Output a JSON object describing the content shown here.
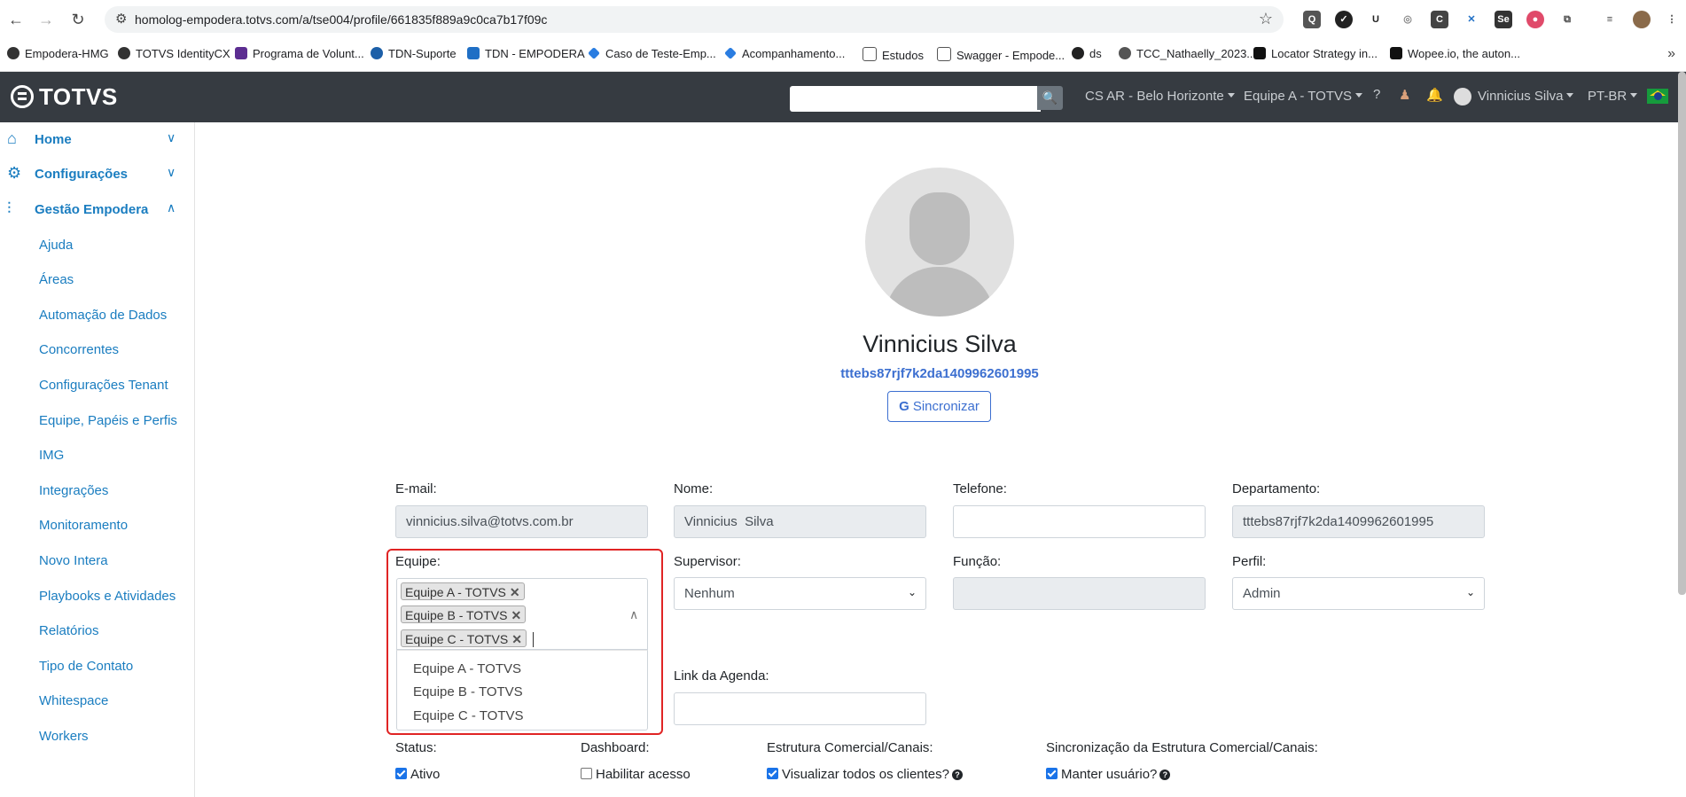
{
  "browser": {
    "url": "homolog-empodera.totvs.com/a/tse004/profile/661835f889a9c0ca7b17f09c",
    "bookmarks": [
      "Empodera-HMG",
      "TOTVS IdentityCX",
      "Programa de Volunt...",
      "TDN-Suporte",
      "TDN - EMPODERA",
      "Caso de Teste-Emp...",
      "Acompanhamento...",
      "Estudos",
      "Swagger - Empode...",
      "ds",
      "TCC_Nathaelly_2023...",
      "Locator Strategy in...",
      "Wopee.io, the auton..."
    ]
  },
  "header": {
    "logo_text": "TOTVS",
    "search_placeholder": "",
    "location": "CS AR - Belo Horizonte",
    "team": "Equipe A - TOTVS",
    "user": "Vinnicius Silva",
    "language": "PT-BR"
  },
  "sidebar": {
    "main_items": [
      {
        "label": "Home",
        "icon": "home-icon"
      },
      {
        "label": "Configurações",
        "icon": "gear-icon"
      },
      {
        "label": "Gestão Empodera",
        "icon": "sliders-icon"
      }
    ],
    "sub_items": [
      "Ajuda",
      "Áreas",
      "Automação de Dados",
      "Concorrentes",
      "Configurações Tenant",
      "Equipe, Papéis e Perfis",
      "IMG",
      "Integrações",
      "Monitoramento",
      "Novo Intera",
      "Playbooks e Atividades",
      "Relatórios",
      "Tipo de Contato",
      "Whitespace",
      "Workers"
    ]
  },
  "profile": {
    "name": "Vinnicius Silva",
    "id": "tttebs87rjf7k2da1409962601995",
    "sync_label": "Sincronizar"
  },
  "form": {
    "email_label": "E-mail:",
    "email_value": "vinnicius.silva@totvs.com.br",
    "nome_label": "Nome:",
    "nome_value": "Vinnicius  Silva",
    "telefone_label": "Telefone:",
    "telefone_value": "",
    "departamento_label": "Departamento:",
    "departamento_value": "tttebs87rjf7k2da1409962601995",
    "equipe_label": "Equipe:",
    "equipe_selected": [
      "Equipe A - TOTVS",
      "Equipe B - TOTVS",
      "Equipe C - TOTVS"
    ],
    "equipe_options": [
      "Equipe A - TOTVS",
      "Equipe B - TOTVS",
      "Equipe C - TOTVS"
    ],
    "supervisor_label": "Supervisor:",
    "supervisor_value": "Nenhum",
    "funcao_label": "Função:",
    "funcao_value": "",
    "perfil_label": "Perfil:",
    "perfil_value": "Admin",
    "agenda_label": "Link da Agenda:",
    "agenda_value": "",
    "status_label": "Status:",
    "status_option": "Ativo",
    "dashboard_label": "Dashboard:",
    "dashboard_option": "Habilitar acesso",
    "estrutura_label": "Estrutura Comercial/Canais:",
    "estrutura_option": "Visualizar todos os clientes?",
    "sync_estrutura_label": "Sincronização da Estrutura Comercial/Canais:",
    "sync_estrutura_option": "Manter usuário?"
  },
  "colors": {
    "header_bg": "#363b41",
    "link_blue": "#1a7dc0",
    "highlight_red": "#e02424"
  }
}
